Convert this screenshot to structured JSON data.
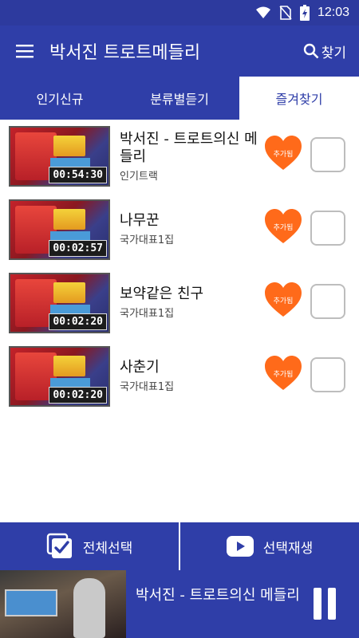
{
  "status_bar": {
    "time": "12:03"
  },
  "app_bar": {
    "title": "박서진 트로트메들리",
    "search_label": "찾기"
  },
  "tabs": [
    {
      "label": "인기신규",
      "active": false
    },
    {
      "label": "분류별듣기",
      "active": false
    },
    {
      "label": "즐겨찾기",
      "active": true
    }
  ],
  "songs": [
    {
      "title": "박서진 - 트로트의신 메들리",
      "subtitle": "인기트랙",
      "duration": "00:54:30",
      "favorite_label": "추가됨"
    },
    {
      "title": "나무꾼",
      "subtitle": "국가대표1집",
      "duration": "00:02:57",
      "favorite_label": "추가됨"
    },
    {
      "title": "보약같은 친구",
      "subtitle": "국가대표1집",
      "duration": "00:02:20",
      "favorite_label": "추가됨"
    },
    {
      "title": "사춘기",
      "subtitle": "국가대표1집",
      "duration": "00:02:20",
      "favorite_label": "추가됨"
    }
  ],
  "bottom_bar": {
    "select_all_label": "전체선택",
    "play_selected_label": "선택재생"
  },
  "player": {
    "now_playing": "박서진 - 트로트의신 메들리"
  },
  "colors": {
    "primary": "#2f3ea8",
    "heart": "#ff6a1a"
  }
}
